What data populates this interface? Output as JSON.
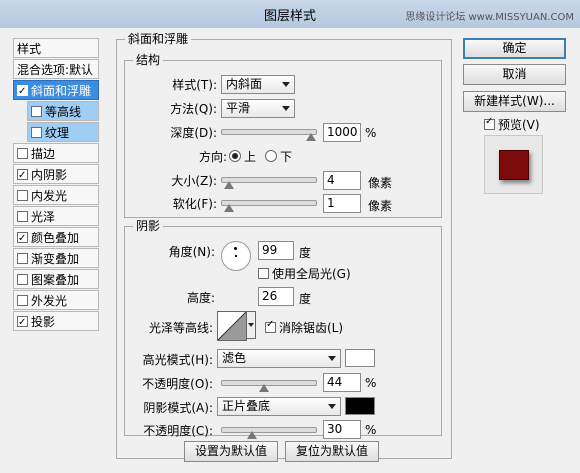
{
  "window": {
    "title": "图层样式",
    "watermark": "思缘设计论坛 www.MISSYUAN.COM"
  },
  "left_panel": {
    "header": "样式",
    "blend_options": "混合选项:默认",
    "items": [
      {
        "label": "斜面和浮雕",
        "checked": true,
        "selected": true,
        "sub": false
      },
      {
        "label": "等高线",
        "checked": false,
        "selected": false,
        "sub": true
      },
      {
        "label": "纹理",
        "checked": false,
        "selected": false,
        "sub": true
      },
      {
        "label": "描边",
        "checked": false,
        "selected": false,
        "sub": false
      },
      {
        "label": "内阴影",
        "checked": true,
        "selected": false,
        "sub": false
      },
      {
        "label": "内发光",
        "checked": false,
        "selected": false,
        "sub": false
      },
      {
        "label": "光泽",
        "checked": false,
        "selected": false,
        "sub": false
      },
      {
        "label": "颜色叠加",
        "checked": true,
        "selected": false,
        "sub": false
      },
      {
        "label": "渐变叠加",
        "checked": false,
        "selected": false,
        "sub": false
      },
      {
        "label": "图案叠加",
        "checked": false,
        "selected": false,
        "sub": false
      },
      {
        "label": "外发光",
        "checked": false,
        "selected": false,
        "sub": false
      },
      {
        "label": "投影",
        "checked": true,
        "selected": false,
        "sub": false
      }
    ]
  },
  "bevel": {
    "group_title": "斜面和浮雕",
    "structure_title": "结构",
    "style_label": "样式(T):",
    "style_value": "内斜面",
    "technique_label": "方法(Q):",
    "technique_value": "平滑",
    "depth_label": "深度(D):",
    "depth_value": "1000",
    "depth_unit": "%",
    "depth_slider": 1.0,
    "direction_label": "方向:",
    "dir_up": "上",
    "dir_down": "下",
    "size_label": "大小(Z):",
    "size_value": "4",
    "size_unit": "像素",
    "size_slider": 0.02,
    "soften_label": "软化(F):",
    "soften_value": "1",
    "soften_unit": "像素",
    "soften_slider": 0.02
  },
  "shading": {
    "title": "阴影",
    "angle_label": "角度(N):",
    "angle_value": "99",
    "angle_unit": "度",
    "global_light": "使用全局光(G)",
    "altitude_label": "高度:",
    "altitude_value": "26",
    "altitude_unit": "度",
    "gloss_label": "光泽等高线:",
    "antialias": "消除锯齿(L)",
    "highlight_label": "高光模式(H):",
    "highlight_mode": "滤色",
    "highlight_color": "#ffffff",
    "hl_opacity_label": "不透明度(O):",
    "hl_opacity_value": "44",
    "hl_opacity_unit": "%",
    "hl_opacity_slider": 0.44,
    "shadow_label": "阴影模式(A):",
    "shadow_mode": "正片叠底",
    "shadow_color": "#000000",
    "sh_opacity_label": "不透明度(C):",
    "sh_opacity_value": "30",
    "sh_opacity_unit": "%",
    "sh_opacity_slider": 0.3
  },
  "bottom_buttons": {
    "make_default": "设置为默认值",
    "reset_default": "复位为默认值"
  },
  "right_buttons": {
    "ok": "确定",
    "cancel": "取消",
    "new_style": "新建样式(W)...",
    "preview": "预览(V)"
  },
  "preview_color": "#7d0b0b"
}
